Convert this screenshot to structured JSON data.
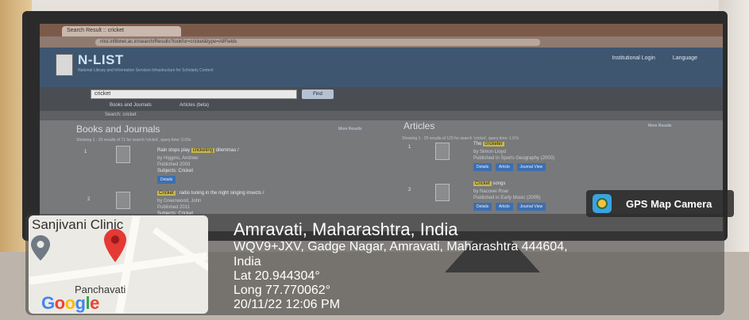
{
  "browser": {
    "tab_title": "Search Result :: cricket",
    "url": "nlist.inflibnet.ac.in/search/Results?lookfor=cricket&type=AllFields"
  },
  "site": {
    "brand": "N-LIST",
    "tagline": "National Library and Information Services Infrastructure for Scholarly Content",
    "links": [
      "Institutional Login",
      "Language"
    ],
    "search_value": "cricket",
    "find_label": "Find",
    "nav": [
      "Books and Journals",
      "Articles (beta)"
    ],
    "breadcrumb": "Search: cricket"
  },
  "results": {
    "books": {
      "title": "Books and Journals",
      "summary": "Showing 1 - 20 results of 71 for search 'cricket', query time: 0.03s",
      "more_link": "More Results",
      "items": [
        {
          "num": "1",
          "pre": "Rain stops play",
          "hl": "cricketing",
          "post": "dilemmas /",
          "by": "by Higgins, Andrew",
          "pub": "Published 2003",
          "subjects": "Subjects: Cricket"
        },
        {
          "num": "2",
          "hl": "Cricket",
          "post": ": radio tuning in the night singing insects /",
          "by": "by Greenwood, John",
          "pub": "Published 2011",
          "subjects": "Subjects: Cricket"
        }
      ]
    },
    "articles": {
      "title": "Articles",
      "summary": "Showing 1 - 20 results of 120 for search 'cricket', query time: 1.07s",
      "more_link": "More Results",
      "items": [
        {
          "num": "1",
          "pre": "The",
          "hl": "cricketer",
          "by": "by Simon Lloyd",
          "pub": "Published in Sports Geography (2000)"
        },
        {
          "num": "2",
          "hl": "Cricket",
          "post": "songs",
          "by": "by Nacovei Roar",
          "pub": "Published in Early Music (2009)"
        }
      ]
    },
    "buttons": [
      "Details",
      "Article",
      "Journal View"
    ]
  },
  "overlay": {
    "badge": "GPS Map Camera",
    "city": "Amravati, Maharashtra, India",
    "address_line1": "WQV9+JXV, Gadge Nagar, Amravati, Maharashtra 444604,",
    "address_line2": "India",
    "lat": "Lat 20.944304°",
    "long": "Long 77.770062°",
    "datetime": "20/11/22 12:06 PM"
  },
  "map": {
    "place_top": "Sanjivani Clinic",
    "place_bottom": "Panchavati",
    "logo": "Google"
  },
  "colors": {
    "header_blue": "#3e5670",
    "pin_red": "#e53935",
    "google_blue": "#4285f4",
    "google_red": "#ea4335",
    "google_yellow": "#fbbc05",
    "google_green": "#34a853"
  }
}
